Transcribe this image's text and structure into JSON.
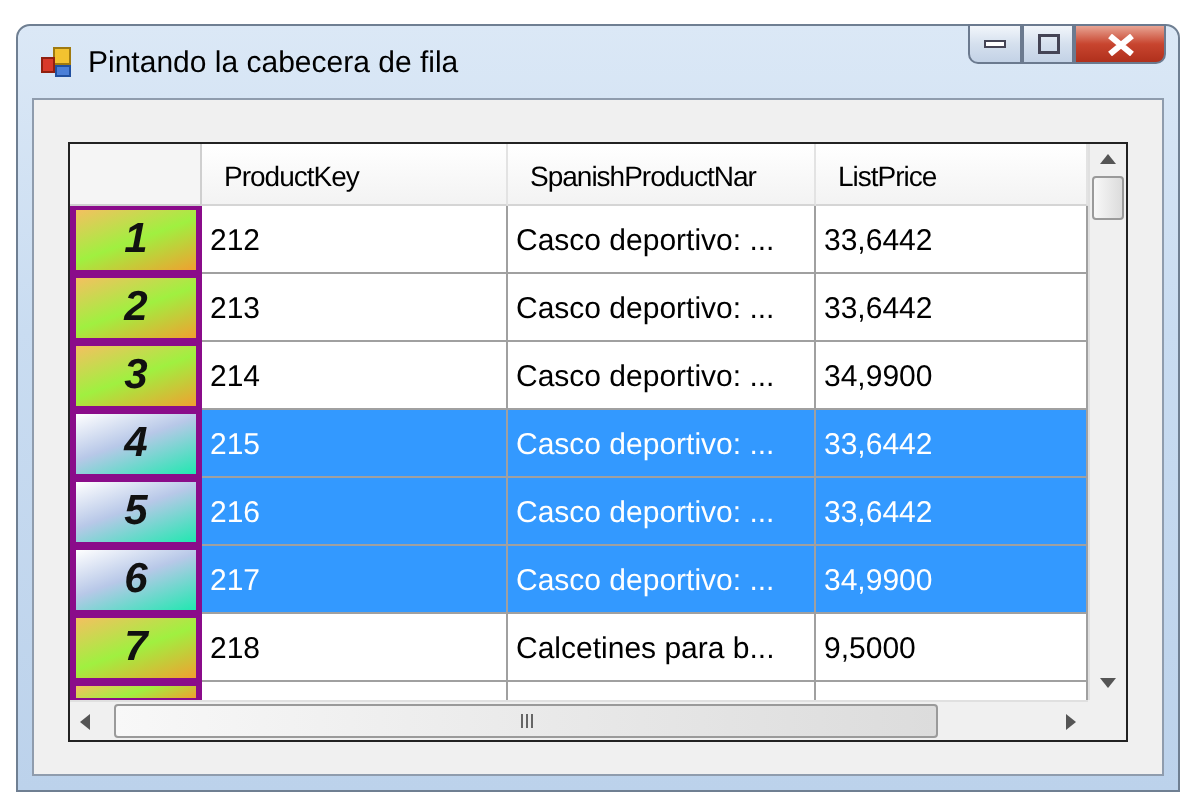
{
  "window": {
    "title": "Pintando la cabecera de fila"
  },
  "table": {
    "columns": [
      "ProductKey",
      "SpanishProductNar",
      "ListPrice"
    ],
    "rows": [
      {
        "header": "1",
        "selected": false,
        "cells": [
          "212",
          "Casco deportivo: ...",
          "33,6442"
        ]
      },
      {
        "header": "2",
        "selected": false,
        "cells": [
          "213",
          "Casco deportivo: ...",
          "33,6442"
        ]
      },
      {
        "header": "3",
        "selected": false,
        "cells": [
          "214",
          "Casco deportivo: ...",
          "34,9900"
        ]
      },
      {
        "header": "4",
        "selected": true,
        "cells": [
          "215",
          "Casco deportivo: ...",
          "33,6442"
        ]
      },
      {
        "header": "5",
        "selected": true,
        "cells": [
          "216",
          "Casco deportivo: ...",
          "33,6442"
        ]
      },
      {
        "header": "6",
        "selected": true,
        "cells": [
          "217",
          "Casco deportivo: ...",
          "34,9900"
        ]
      },
      {
        "header": "7",
        "selected": false,
        "cells": [
          "218",
          "Calcetines para b...",
          "9,5000"
        ]
      }
    ]
  }
}
